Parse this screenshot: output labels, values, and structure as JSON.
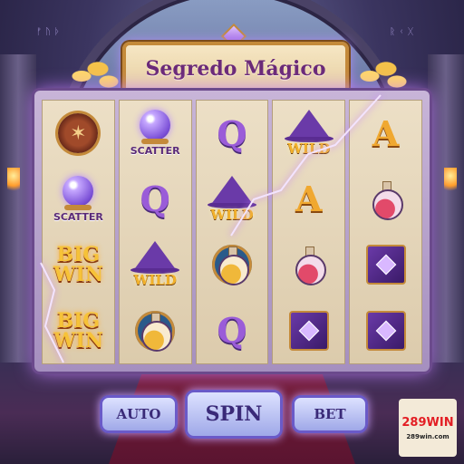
{
  "game": {
    "title": "Segredo Mágico"
  },
  "reels": [
    [
      "dragon",
      "scatter",
      "bigwin",
      "bigwin"
    ],
    [
      "scatter",
      "Q",
      "wild",
      "potion-gold"
    ],
    [
      "Q",
      "wild",
      "potion-gold",
      "Q"
    ],
    [
      "wild",
      "A",
      "potion-red",
      "book"
    ],
    [
      "A",
      "potion-red",
      "book",
      "book"
    ]
  ],
  "symbols": {
    "scatter_label": "SCATTER",
    "wild_label": "WILD",
    "bigwin_line1": "BIG",
    "bigwin_line2": "WIN",
    "q_letter": "Q",
    "a_letter": "A"
  },
  "controls": {
    "auto_label": "AUTO",
    "spin_label": "SPIN",
    "bet_label": "BET"
  },
  "logo": {
    "main": "289WIN",
    "sub": "289win.com"
  },
  "colors": {
    "accent": "#c77dff",
    "gold": "#f2b12a",
    "title": "#6a2a78"
  }
}
